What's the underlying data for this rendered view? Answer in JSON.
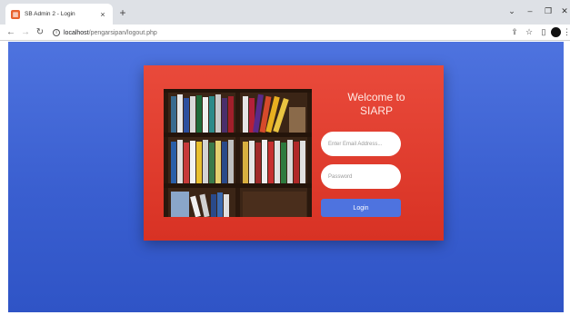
{
  "browser": {
    "tab_title": "SB Admin 2 - Login",
    "tab_close": "×",
    "new_tab": "+",
    "url_host": "localhost",
    "url_path": "/pengarsipan/logout.php",
    "icons": {
      "favicon": "page-icon",
      "back": "back-arrow-icon",
      "forward": "forward-arrow-icon",
      "reload": "reload-icon",
      "site_info": "info-icon",
      "share": "share-icon",
      "bookmark": "star-icon",
      "sidebar": "side-panel-icon",
      "profile": "profile-avatar-icon",
      "menu": "menu-icon"
    },
    "window_controls": {
      "dropdown": "⌄",
      "minimize": "–",
      "restore": "❐",
      "close": "✕"
    }
  },
  "login": {
    "welcome_line1": "Welcome to",
    "welcome_line2": "SIARP",
    "email_placeholder": "Enter Email Address...",
    "password_placeholder": "Password",
    "login_label": "Login"
  },
  "colors": {
    "page_bg": "#4e73df",
    "card_bg": "#e74a3b",
    "button_bg": "#4e73df"
  }
}
